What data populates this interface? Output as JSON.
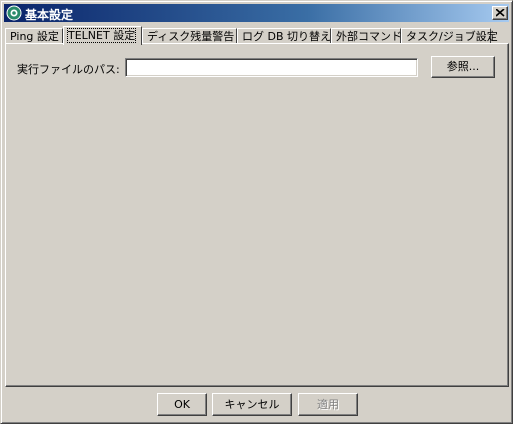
{
  "window": {
    "title": "基本設定",
    "icon": "app-gear-icon",
    "close_icon": "close-icon"
  },
  "tabs": [
    {
      "label": "Ping 設定",
      "active": false
    },
    {
      "label": "TELNET 設定",
      "active": true
    },
    {
      "label": "ディスク残量警告",
      "active": false
    },
    {
      "label": "ログ DB 切り替え",
      "active": false
    },
    {
      "label": "外部コマンド",
      "active": false
    },
    {
      "label": "タスク/ジョブ設定",
      "active": false
    }
  ],
  "telnet": {
    "path_label": "実行ファイルのパス:",
    "path_value": "",
    "browse_label": "参照..."
  },
  "footer": {
    "ok_label": "OK",
    "cancel_label": "キャンセル",
    "apply_label": "適用",
    "apply_enabled": false
  },
  "colors": {
    "face": "#d4d0c8",
    "title_start": "#0a246a",
    "title_end": "#a6caf0",
    "disabled_text": "#808080"
  }
}
